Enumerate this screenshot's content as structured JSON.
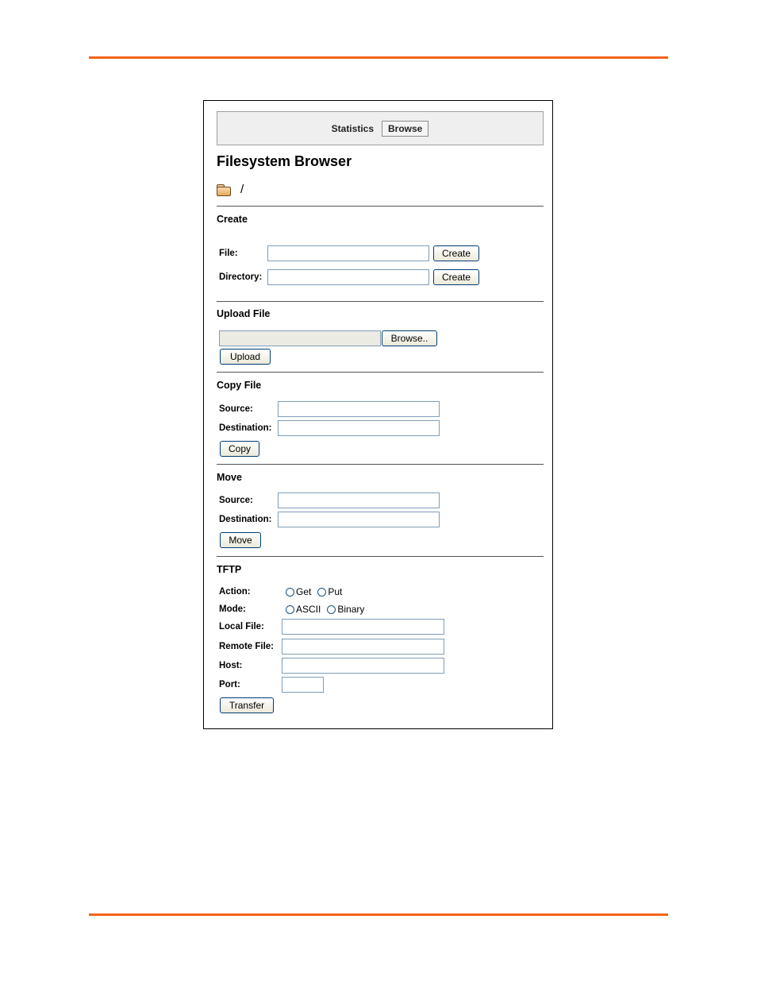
{
  "nav": {
    "items": [
      {
        "label": "Statistics",
        "active": false
      },
      {
        "label": "Browse",
        "active": true
      }
    ]
  },
  "page_title": "Filesystem Browser",
  "path": {
    "icon": "folder-icon",
    "current": "/"
  },
  "create": {
    "title": "Create",
    "file_label": "File:",
    "file_value": "",
    "file_button": "Create",
    "directory_label": "Directory:",
    "directory_value": "",
    "directory_button": "Create"
  },
  "upload": {
    "title": "Upload File",
    "file_value": "",
    "browse_button": "Browse..",
    "upload_button": "Upload"
  },
  "copy": {
    "title": "Copy File",
    "source_label": "Source:",
    "source_value": "",
    "destination_label": "Destination:",
    "destination_value": "",
    "button": "Copy"
  },
  "move": {
    "title": "Move",
    "source_label": "Source:",
    "source_value": "",
    "destination_label": "Destination:",
    "destination_value": "",
    "button": "Move"
  },
  "tftp": {
    "title": "TFTP",
    "action_label": "Action:",
    "action_options": [
      "Get",
      "Put"
    ],
    "mode_label": "Mode:",
    "mode_options": [
      "ASCII",
      "Binary"
    ],
    "local_file_label": "Local File:",
    "local_file_value": "",
    "remote_file_label": "Remote File:",
    "remote_file_value": "",
    "host_label": "Host:",
    "host_value": "",
    "port_label": "Port:",
    "port_value": "",
    "button": "Transfer"
  },
  "colors": {
    "accent_rule": "#f26419",
    "navbar_bg": "#efefef",
    "input_border": "#7f9db9",
    "button_border": "#003c74"
  }
}
